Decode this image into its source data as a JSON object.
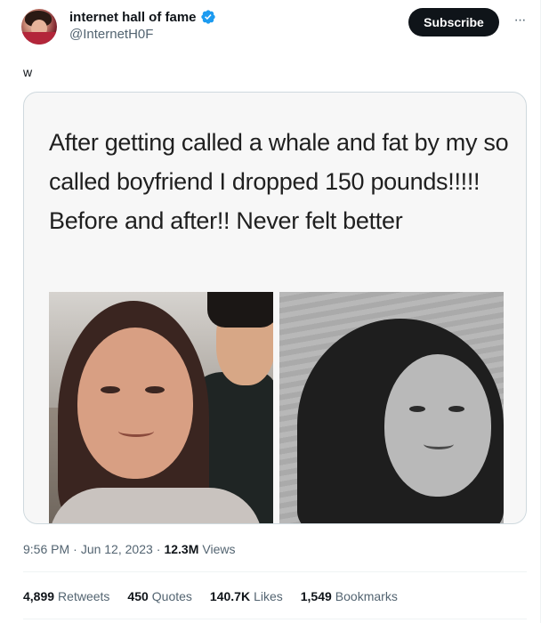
{
  "author": {
    "display_name": "internet hall of fame",
    "handle": "@InternetH0F",
    "verified_icon": "verified-badge-icon"
  },
  "header": {
    "subscribe_label": "Subscribe",
    "more_icon": "more-options-icon",
    "more_glyph": "···"
  },
  "tweet": {
    "text": "w",
    "media_caption": "After getting called a whale and fat by my so called boyfriend I dropped 150 pounds!!!!! Before and after!! Never felt better"
  },
  "meta": {
    "time": "9:56 PM",
    "sep1": "·",
    "date": "Jun 12, 2023",
    "sep2": "·",
    "views_count": "12.3M",
    "views_label": "Views"
  },
  "stats": {
    "retweets": {
      "count": "4,899",
      "label": "Retweets"
    },
    "quotes": {
      "count": "450",
      "label": "Quotes"
    },
    "likes": {
      "count": "140.7K",
      "label": "Likes"
    },
    "bookmarks": {
      "count": "1,549",
      "label": "Bookmarks"
    }
  },
  "colors": {
    "primary_text": "#0f1419",
    "secondary_text": "#536471",
    "verified_blue": "#1d9bf0",
    "border": "#cfd9de"
  }
}
